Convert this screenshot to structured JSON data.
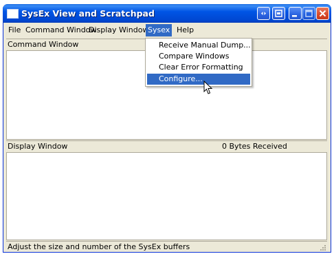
{
  "window": {
    "title": "SysEx View and Scratchpad"
  },
  "menubar": {
    "items": [
      {
        "label": "File"
      },
      {
        "label": "Command Window"
      },
      {
        "label": "Display Window"
      },
      {
        "label": "Sysex"
      },
      {
        "label": "Help"
      }
    ]
  },
  "sysex_menu": {
    "items": [
      {
        "label": "Receive Manual Dump..."
      },
      {
        "label": "Compare Windows"
      },
      {
        "label": "Clear Error Formatting"
      },
      {
        "label": "Configure..."
      }
    ]
  },
  "command_pane": {
    "label": "Command Window"
  },
  "display_pane": {
    "label": "Display Window",
    "bytes_received": "0  Bytes Received"
  },
  "statusbar": {
    "text": "Adjust the size and number of the SysEx buffers"
  },
  "colors": {
    "title_blue": "#0055e5",
    "highlight": "#316ac5",
    "face": "#ece9d8"
  }
}
